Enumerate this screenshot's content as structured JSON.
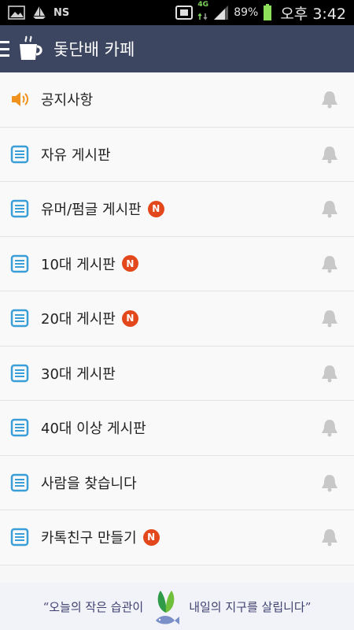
{
  "status_bar": {
    "carrier": "NS",
    "network": "4G",
    "battery": "89%",
    "time": "오후 3:42"
  },
  "app_bar": {
    "title": "돛단배 카페",
    "icons": [
      "menu-icon",
      "coffee-cup-icon"
    ],
    "color": "#3d4660"
  },
  "boards": [
    {
      "label": "공지사항",
      "icon": "speaker-icon",
      "new": false
    },
    {
      "label": "자유 게시판",
      "icon": "document-icon",
      "new": false
    },
    {
      "label": "유머/펌글 게시판",
      "icon": "document-icon",
      "new": true
    },
    {
      "label": "10대 게시판",
      "icon": "document-icon",
      "new": true
    },
    {
      "label": "20대 게시판",
      "icon": "document-icon",
      "new": true
    },
    {
      "label": "30대 게시판",
      "icon": "document-icon",
      "new": false
    },
    {
      "label": "40대 이상 게시판",
      "icon": "document-icon",
      "new": false
    },
    {
      "label": "사람을 찾습니다",
      "icon": "document-icon",
      "new": false
    },
    {
      "label": "카톡친구 만들기",
      "icon": "document-icon",
      "new": true
    }
  ],
  "new_badge": "N",
  "banner": {
    "left_text": "“오늘의 작은 습관이",
    "right_text": "내일의 지구를 살립니다”"
  },
  "colors": {
    "accent_orange": "#f0921e",
    "doc_blue": "#3a9fd8",
    "badge_red": "#e3481c",
    "bell_gray": "#c8c8c8"
  }
}
